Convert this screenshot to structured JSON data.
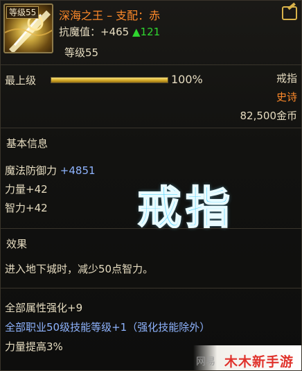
{
  "item": {
    "level_badge": "等级55",
    "name": "深海之王 – 支配：赤",
    "resist_label": "抗魔值：",
    "resist_value": "+465",
    "resist_gain": "▲121",
    "level_line": "等级55",
    "name_color": "#ff8a2a"
  },
  "upgrade": {
    "label": "最上级",
    "progress": 1.0,
    "percent_text": "100%"
  },
  "meta": {
    "type": "戒指",
    "rarity": "史诗",
    "price": "82,500金币"
  },
  "basic_info": {
    "title": "基本信息",
    "stats": [
      {
        "label": "魔法防御力",
        "value": " +4851"
      },
      {
        "label": "力量+42",
        "value": ""
      },
      {
        "label": "智力+42",
        "value": ""
      }
    ]
  },
  "watermark_text": "戒指",
  "effects": {
    "title": "效果",
    "line1": "进入地下城时，减少50点智力。",
    "line2": "全部属性强化+9",
    "line3": "全部职业50级技能等级+1（强化技能除外）",
    "line4": "力量提高3%"
  },
  "footer": {
    "left_text": "网易",
    "right_text": "木木新手游"
  },
  "icons": [
    "ring-item-icon",
    "edit-share-icon"
  ]
}
